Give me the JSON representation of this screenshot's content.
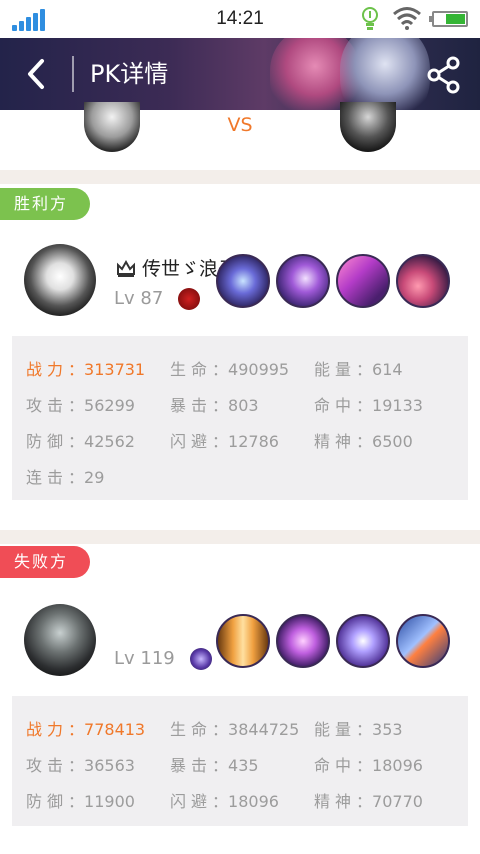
{
  "status": {
    "time": "14:21"
  },
  "nav": {
    "title": "PK详情"
  },
  "vs": {
    "label": "VS"
  },
  "winner": {
    "tag": "胜利方",
    "name": "传世ゞ浪子",
    "level": "Lv 87",
    "stats": [
      {
        "key": "战力",
        "value": "313731",
        "highlight": true
      },
      {
        "key": "生命",
        "value": "490995"
      },
      {
        "key": "能量",
        "value": "614"
      },
      {
        "key": "攻击",
        "value": "56299"
      },
      {
        "key": "暴击",
        "value": "803"
      },
      {
        "key": "命中",
        "value": "19133"
      },
      {
        "key": "防御",
        "value": "42562"
      },
      {
        "key": "闪避",
        "value": "12786"
      },
      {
        "key": "精神",
        "value": "6500"
      },
      {
        "key": "连击",
        "value": "29"
      }
    ]
  },
  "loser": {
    "tag": "失败方",
    "level": "Lv 119",
    "stats": [
      {
        "key": "战力",
        "value": "778413",
        "highlight": true
      },
      {
        "key": "生命",
        "value": "3844725"
      },
      {
        "key": "能量",
        "value": "353"
      },
      {
        "key": "攻击",
        "value": "36563"
      },
      {
        "key": "暴击",
        "value": "435"
      },
      {
        "key": "命中",
        "value": "18096"
      },
      {
        "key": "防御",
        "value": "11900"
      },
      {
        "key": "闪避",
        "value": "18096"
      },
      {
        "key": "精神",
        "value": "70770"
      }
    ]
  },
  "colors": {
    "accent": "#f0782a",
    "win": "#7cc24e",
    "lose": "#f04d56",
    "statusIcon": "#2f8ee0"
  },
  "icons": [
    "signal-icon",
    "bulb-icon",
    "wifi-icon",
    "battery-icon",
    "back-icon",
    "share-icon",
    "crown-icon"
  ]
}
